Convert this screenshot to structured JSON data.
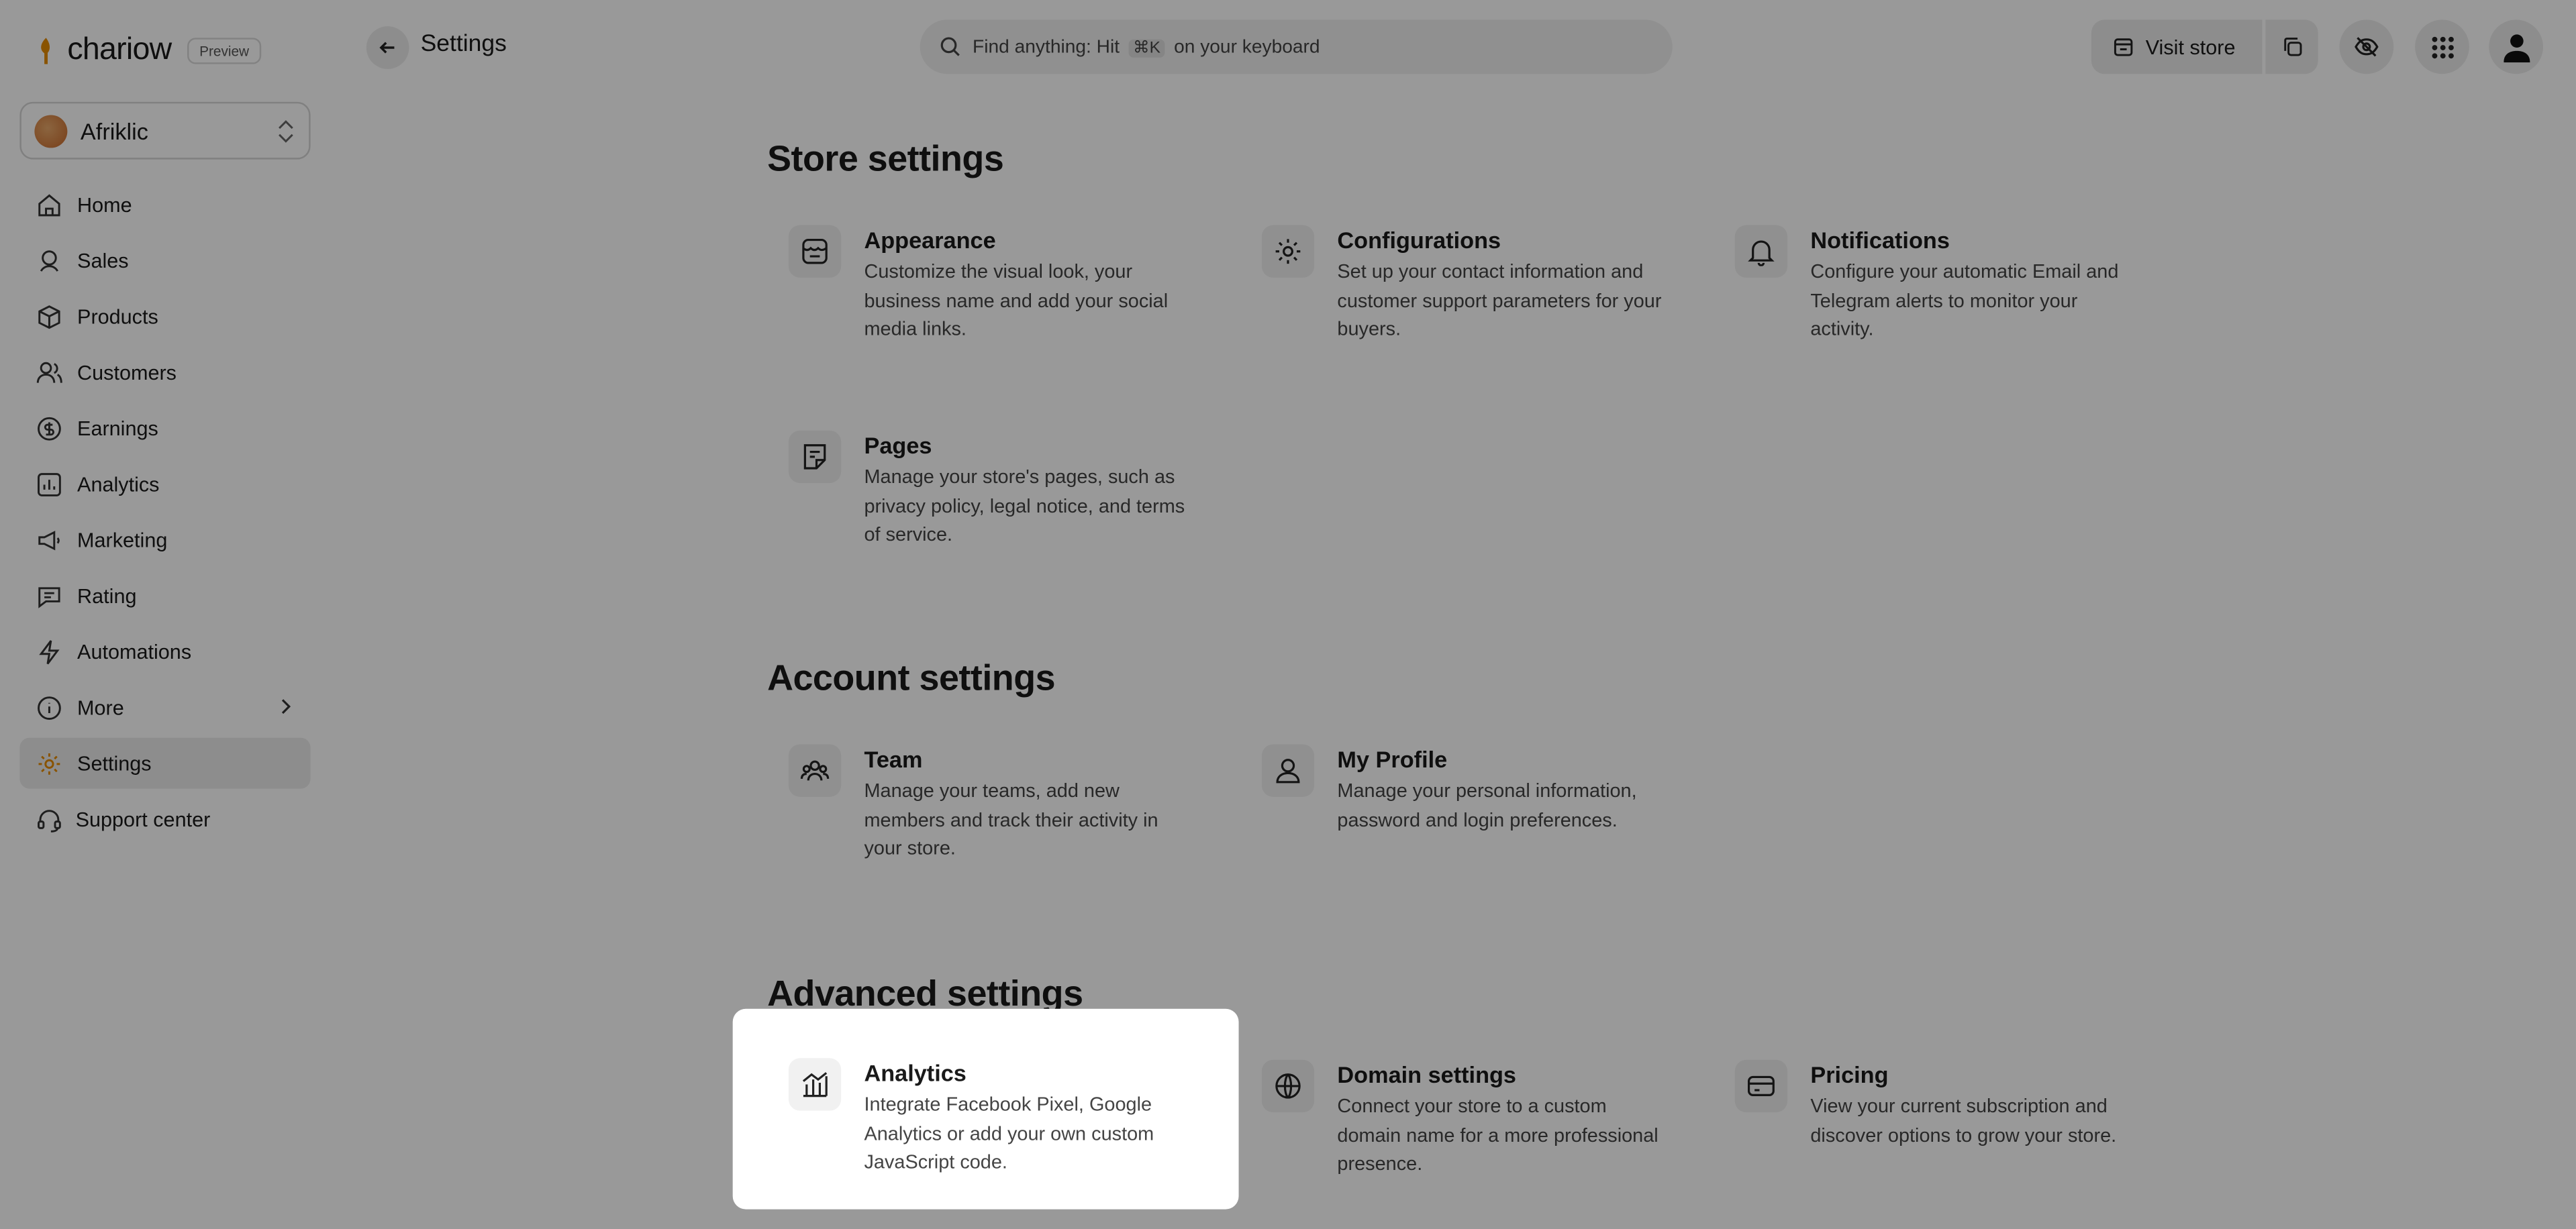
{
  "app": {
    "logo_text": "chariow",
    "preview_badge": "Preview"
  },
  "header": {
    "title": "Settings",
    "search_prefix": "Find anything: Hit",
    "search_shortcut": "⌘K",
    "search_suffix": "on your keyboard",
    "visit_store_label": "Visit store"
  },
  "sidebar": {
    "store_name": "Afriklic",
    "items": [
      {
        "label": "Home",
        "icon": "home-icon"
      },
      {
        "label": "Sales",
        "icon": "sales-icon"
      },
      {
        "label": "Products",
        "icon": "box-icon"
      },
      {
        "label": "Customers",
        "icon": "users-icon"
      },
      {
        "label": "Earnings",
        "icon": "dollar-icon"
      },
      {
        "label": "Analytics",
        "icon": "chart-icon"
      },
      {
        "label": "Marketing",
        "icon": "megaphone-icon"
      },
      {
        "label": "Rating",
        "icon": "comment-icon"
      },
      {
        "label": "Automations",
        "icon": "bolt-icon"
      },
      {
        "label": "More",
        "icon": "info-icon"
      },
      {
        "label": "Settings",
        "icon": "gear-icon"
      }
    ],
    "support_label": "Support center"
  },
  "sections": {
    "store": {
      "title": "Store settings",
      "cards": [
        {
          "title": "Appearance",
          "desc": "Customize the visual look, your business name and add your social media links."
        },
        {
          "title": "Configurations",
          "desc": "Set up your contact information and customer support parameters for your buyers."
        },
        {
          "title": "Notifications",
          "desc": "Configure your automatic Email and Telegram alerts to monitor your activity."
        },
        {
          "title": "Pages",
          "desc": "Manage your store's pages, such as privacy policy, legal notice, and terms of service."
        }
      ]
    },
    "account": {
      "title": "Account settings",
      "cards": [
        {
          "title": "Team",
          "desc": "Manage your teams, add new members and track their activity in your store."
        },
        {
          "title": "My Profile",
          "desc": "Manage your personal information, password and login preferences."
        }
      ]
    },
    "advanced": {
      "title": "Advanced settings",
      "cards": [
        {
          "title": "Analytics",
          "desc": "Integrate Facebook Pixel, Google Analytics or add your own custom JavaScript code."
        },
        {
          "title": "Domain settings",
          "desc": "Connect your store to a custom domain name for a more professional presence."
        },
        {
          "title": "Pricing",
          "desc": "View your current subscription and discover options to grow your store."
        }
      ]
    }
  }
}
